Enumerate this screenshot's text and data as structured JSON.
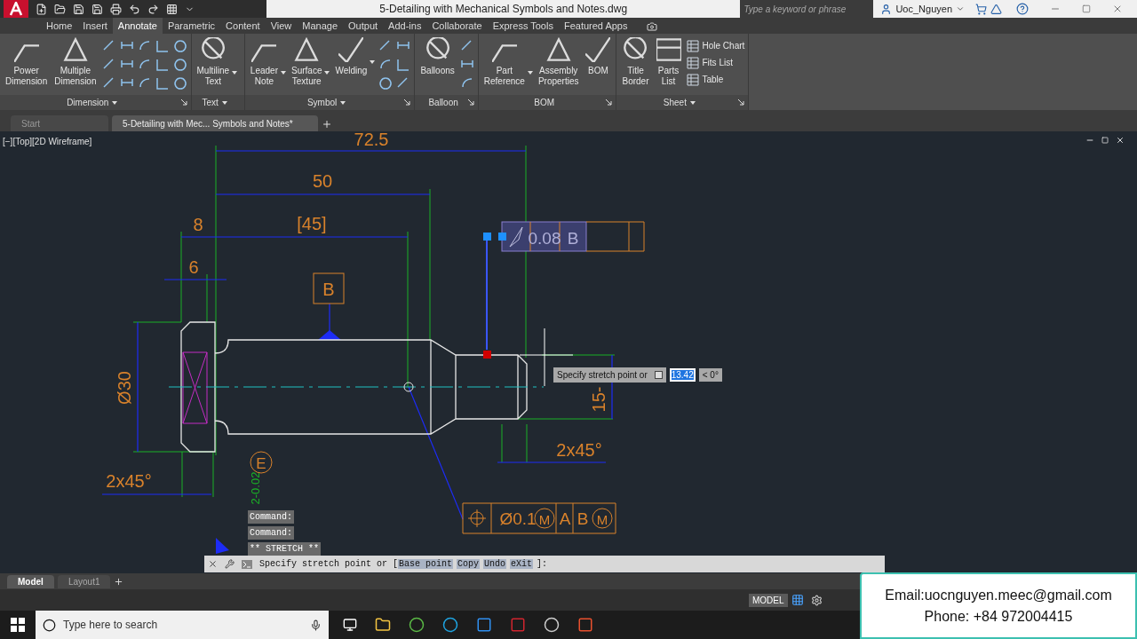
{
  "app": {
    "title": "5-Detailing with Mechanical Symbols and Notes.dwg",
    "search_placeholder": "Type a keyword or phrase",
    "user": "Uoc_Nguyen"
  },
  "menu_tabs": [
    {
      "label": "Home",
      "selected": false
    },
    {
      "label": "Insert",
      "selected": false
    },
    {
      "label": "Annotate",
      "selected": true
    },
    {
      "label": "Parametric",
      "selected": false
    },
    {
      "label": "Content",
      "selected": false
    },
    {
      "label": "View",
      "selected": false
    },
    {
      "label": "Manage",
      "selected": false
    },
    {
      "label": "Output",
      "selected": false
    },
    {
      "label": "Add-ins",
      "selected": false
    },
    {
      "label": "Collaborate",
      "selected": false
    },
    {
      "label": "Express Tools",
      "selected": false
    },
    {
      "label": "Featured Apps",
      "selected": false
    }
  ],
  "ribbon_panels": [
    {
      "title": "Dimension",
      "dropdown": true,
      "launcher": true,
      "tools": [
        {
          "label": "Power\nDimension",
          "dropdown": false
        },
        {
          "label": "Multiple\nDimension",
          "dropdown": false
        }
      ]
    },
    {
      "title": "Text",
      "dropdown": true,
      "launcher": false,
      "tools": [
        {
          "label": "Multiline\nText",
          "dropdown": true
        }
      ]
    },
    {
      "title": "Symbol",
      "dropdown": true,
      "launcher": true,
      "tools": [
        {
          "label": "Leader\nNote",
          "dropdown": true
        },
        {
          "label": "Surface\nTexture",
          "dropdown": true
        },
        {
          "label": "Welding",
          "dropdown": true
        }
      ]
    },
    {
      "title": "Balloon",
      "dropdown": false,
      "launcher": true,
      "tools": [
        {
          "label": "Balloons",
          "dropdown": false
        }
      ]
    },
    {
      "title": "BOM",
      "dropdown": false,
      "launcher": true,
      "tools": [
        {
          "label": "Part\nReference",
          "dropdown": true
        },
        {
          "label": "Assembly\nProperties",
          "dropdown": false
        },
        {
          "label": "BOM",
          "dropdown": false
        }
      ]
    },
    {
      "title": "Sheet",
      "dropdown": true,
      "launcher": true,
      "tools": [
        {
          "label": "Title\nBorder",
          "dropdown": false
        },
        {
          "label": "Parts\nList",
          "dropdown": false
        }
      ],
      "list_tools": [
        "Hole Chart",
        "Fits List",
        "Table"
      ]
    }
  ],
  "file_tabs": [
    {
      "label": "Start",
      "selected": false
    },
    {
      "label": "5-Detailing with Mec... Symbols and Notes*",
      "selected": true
    }
  ],
  "viewport_label": "[−][Top][2D Wireframe]",
  "drawing": {
    "dimension_texts": [
      "72.5",
      "50",
      "8",
      "[45]",
      "6",
      "Ø30",
      "2x45°",
      "2x45°",
      "15-"
    ],
    "tolerance_text": "2-0.02",
    "datum_label": "B",
    "circled_label": "E",
    "top_frame": {
      "selected": true,
      "cells": [
        "0.08",
        "B"
      ]
    },
    "bottom_frame": {
      "selected": false,
      "cells": [
        "Ø0.1",
        "M",
        "A",
        "B",
        "M"
      ]
    }
  },
  "stretch_tooltip": {
    "prompt": "Specify stretch point or",
    "value": "13.42",
    "angle": "< 0°"
  },
  "command_history": [
    "Command:",
    "Command:",
    "** STRETCH **"
  ],
  "command_line": {
    "prompt": "Specify stretch point or [",
    "options": [
      "Base point",
      "Copy",
      "Undo",
      "eXit"
    ],
    "suffix": "]:"
  },
  "layout_tabs": [
    {
      "label": "Model",
      "selected": true
    },
    {
      "label": "Layout1",
      "selected": false
    }
  ],
  "status_bar": {
    "space": "MODEL"
  },
  "taskbar": {
    "search_placeholder": "Type here to search"
  },
  "contact": {
    "email": "Email:uocnguyen.meec@gmail.com",
    "phone": "Phone: +84 972004415"
  }
}
